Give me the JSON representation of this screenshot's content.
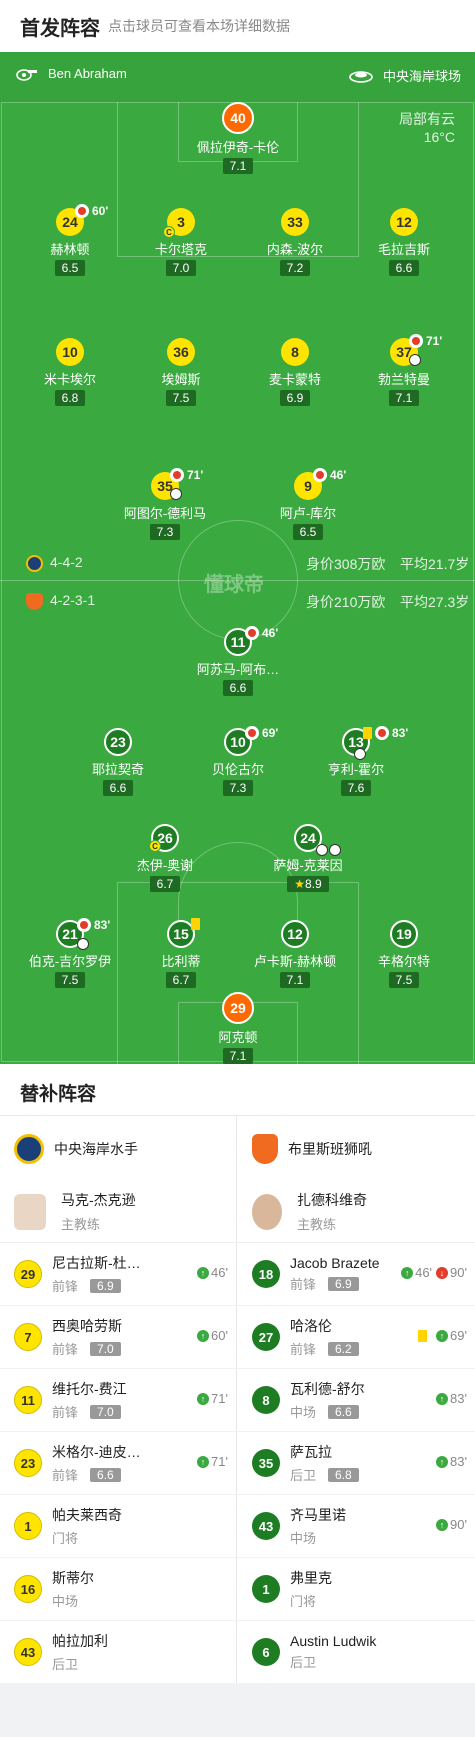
{
  "header": {
    "title": "首发阵容",
    "subtitle": "点击球员可查看本场详细数据"
  },
  "info": {
    "referee": "Ben Abraham",
    "venue": "中央海岸球场",
    "weather": "局部有云",
    "temp": "16°C"
  },
  "home_row": {
    "formation": "4-4-2",
    "value": "身价308万欧",
    "age": "平均21.7岁"
  },
  "away_row": {
    "formation": "4-2-3-1",
    "value": "身价210万欧",
    "age": "平均27.3岁"
  },
  "watermark": "懂球帝",
  "home_players": [
    {
      "num": "40",
      "name": "佩拉伊奇-卡伦",
      "rating": "7.1"
    },
    {
      "num": "24",
      "name": "赫林顿",
      "rating": "6.5",
      "event": "60'"
    },
    {
      "num": "3",
      "name": "卡尔塔克",
      "rating": "7.0",
      "captain": "C"
    },
    {
      "num": "33",
      "name": "内森-波尔",
      "rating": "7.2"
    },
    {
      "num": "12",
      "name": "毛拉吉斯",
      "rating": "6.6"
    },
    {
      "num": "10",
      "name": "米卡埃尔",
      "rating": "6.8"
    },
    {
      "num": "36",
      "name": "埃姆斯",
      "rating": "7.5"
    },
    {
      "num": "8",
      "name": "麦卡蒙特",
      "rating": "6.9"
    },
    {
      "num": "37",
      "name": "勃兰特曼",
      "rating": "7.1",
      "event": "71'"
    },
    {
      "num": "35",
      "name": "阿图尔-德利马",
      "rating": "7.3",
      "event": "71'"
    },
    {
      "num": "9",
      "name": "阿卢-库尔",
      "rating": "6.5",
      "event": "46'"
    }
  ],
  "away_players": [
    {
      "num": "11",
      "name": "阿苏马-阿布…",
      "rating": "6.6",
      "event": "46'"
    },
    {
      "num": "23",
      "name": "耶拉契奇",
      "rating": "6.6"
    },
    {
      "num": "10",
      "name": "贝伦古尔",
      "rating": "7.3",
      "event": "69'"
    },
    {
      "num": "13",
      "name": "亨利-霍尔",
      "rating": "7.6",
      "event": "83'"
    },
    {
      "num": "26",
      "name": "杰伊-奥谢",
      "rating": "6.7",
      "captain": "C"
    },
    {
      "num": "24",
      "name": "萨姆-克莱因",
      "rating": "8.9",
      "star": "★"
    },
    {
      "num": "21",
      "name": "伯克-吉尔罗伊",
      "rating": "7.5",
      "event": "83'"
    },
    {
      "num": "15",
      "name": "比利蒂",
      "rating": "6.7"
    },
    {
      "num": "12",
      "name": "卢卡斯-赫林顿",
      "rating": "7.1"
    },
    {
      "num": "19",
      "name": "辛格尔特",
      "rating": "7.5"
    },
    {
      "num": "29",
      "name": "阿克顿",
      "rating": "7.1"
    }
  ],
  "subs": {
    "title": "替补阵容",
    "home": {
      "team": "中央海岸水手",
      "coach": {
        "name": "马克-杰克逊",
        "role": "主教练"
      },
      "players": [
        {
          "num": "29",
          "name": "尼古拉斯-杜…",
          "pos": "前锋",
          "rating": "6.9",
          "in": "46'"
        },
        {
          "num": "7",
          "name": "西奥哈劳斯",
          "pos": "前锋",
          "rating": "7.0",
          "in": "60'"
        },
        {
          "num": "11",
          "name": "维托尔-费江",
          "pos": "前锋",
          "rating": "7.0",
          "in": "71'"
        },
        {
          "num": "23",
          "name": "米格尔-迪皮…",
          "pos": "前锋",
          "rating": "6.6",
          "in": "71'"
        },
        {
          "num": "1",
          "name": "帕夫莱西奇",
          "pos": "门将"
        },
        {
          "num": "16",
          "name": "斯蒂尔",
          "pos": "中场"
        },
        {
          "num": "43",
          "name": "帕拉加利",
          "pos": "后卫"
        }
      ]
    },
    "away": {
      "team": "布里斯班狮吼",
      "coach": {
        "name": "扎德科维奇",
        "role": "主教练"
      },
      "players": [
        {
          "num": "18",
          "name": "Jacob Brazete",
          "pos": "前锋",
          "rating": "6.9",
          "in": "46'",
          "out": "90'"
        },
        {
          "num": "27",
          "name": "哈洛伦",
          "pos": "前锋",
          "rating": "6.2",
          "in": "69'",
          "card": "yellow"
        },
        {
          "num": "8",
          "name": "瓦利德-舒尔",
          "pos": "中场",
          "rating": "6.6",
          "in": "83'"
        },
        {
          "num": "35",
          "name": "萨瓦拉",
          "pos": "后卫",
          "rating": "6.8",
          "in": "83'"
        },
        {
          "num": "43",
          "name": "齐马里诺",
          "pos": "中场",
          "in": "90'"
        },
        {
          "num": "1",
          "name": "弗里克",
          "pos": "门将"
        },
        {
          "num": "6",
          "name": "Austin Ludwik",
          "pos": "后卫"
        }
      ]
    }
  }
}
